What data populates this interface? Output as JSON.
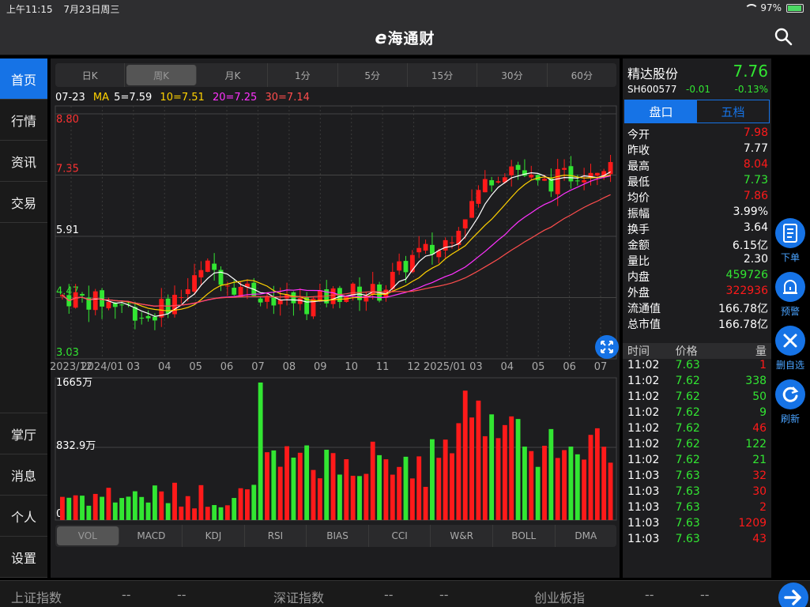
{
  "status": {
    "time": "上午11:15",
    "date": "7月23日周三",
    "battery": "97%"
  },
  "nav": {
    "logo_e": "e",
    "logo_text": "海通财"
  },
  "left_nav": {
    "top": [
      {
        "label": "首页"
      },
      {
        "label": "行情"
      },
      {
        "label": "资讯"
      },
      {
        "label": "交易"
      }
    ],
    "bottom": [
      {
        "label": "掌厅"
      },
      {
        "label": "消息"
      },
      {
        "label": "个人"
      },
      {
        "label": "设置"
      }
    ]
  },
  "period_tabs": [
    "日K",
    "周K",
    "月K",
    "1分",
    "5分",
    "15分",
    "30分",
    "60分"
  ],
  "active_period": 1,
  "ma": {
    "date": "07-23",
    "label": "MA",
    "ma5": "5=7.59",
    "ma10": "10=7.51",
    "ma20": "20=7.25",
    "ma30": "30=7.14"
  },
  "colors": {
    "up": "#ff1a1a",
    "down": "#32e632",
    "ma5": "#ffffff",
    "ma10": "#ffd200",
    "ma20": "#ff32ff",
    "ma30": "#ff4d4d",
    "accent": "#1673e6"
  },
  "price_axis": [
    "8.80",
    "7.35",
    "5.91",
    "4.47",
    "3.03"
  ],
  "date_axis": [
    "2023/12",
    "2024/01",
    "03",
    "04",
    "05",
    "06",
    "07",
    "08",
    "09",
    "10",
    "11",
    "12",
    "2025/01",
    "03",
    "04",
    "05",
    "06",
    "07"
  ],
  "vol_axis": [
    "1665万",
    "832.9万",
    "0"
  ],
  "indicator_tabs": [
    "VOL",
    "MACD",
    "KDJ",
    "RSI",
    "BIAS",
    "CCI",
    "W&R",
    "BOLL",
    "DMA"
  ],
  "active_indicator": 0,
  "stock": {
    "name": "精达股份",
    "price": "7.76",
    "code": "SH600577",
    "change": "-0.01",
    "change_pct": "-0.13%"
  },
  "panel_tabs": [
    "盘口",
    "五档"
  ],
  "quote": [
    {
      "k": "今开",
      "v": "7.98",
      "c": "up"
    },
    {
      "k": "昨收",
      "v": "7.77",
      "c": "flat"
    },
    {
      "k": "最高",
      "v": "8.04",
      "c": "up"
    },
    {
      "k": "最低",
      "v": "7.73",
      "c": "down"
    },
    {
      "k": "均价",
      "v": "7.86",
      "c": "up"
    },
    {
      "k": "振幅",
      "v": "3.99%",
      "c": "flat"
    },
    {
      "k": "换手",
      "v": "3.64",
      "c": "flat"
    },
    {
      "k": "金额",
      "v": "6.15亿",
      "c": "flat"
    },
    {
      "k": "量比",
      "v": "2.30",
      "c": "flat"
    },
    {
      "k": "内盘",
      "v": "459726",
      "c": "down"
    },
    {
      "k": "外盘",
      "v": "322936",
      "c": "up"
    },
    {
      "k": "流通值",
      "v": "166.78亿",
      "c": "flat"
    },
    {
      "k": "总市值",
      "v": "166.78亿",
      "c": "flat"
    }
  ],
  "ticks_head": [
    "时间",
    "价格",
    "量"
  ],
  "ticks": [
    [
      "11:02",
      "7.63",
      "1",
      "up"
    ],
    [
      "11:02",
      "7.62",
      "338",
      "down"
    ],
    [
      "11:02",
      "7.62",
      "50",
      "down"
    ],
    [
      "11:02",
      "7.62",
      "9",
      "down"
    ],
    [
      "11:02",
      "7.62",
      "46",
      "up"
    ],
    [
      "11:02",
      "7.62",
      "122",
      "down"
    ],
    [
      "11:02",
      "7.62",
      "21",
      "down"
    ],
    [
      "11:03",
      "7.63",
      "32",
      "up"
    ],
    [
      "11:03",
      "7.63",
      "30",
      "up"
    ],
    [
      "11:03",
      "7.63",
      "2",
      "up"
    ],
    [
      "11:03",
      "7.63",
      "1209",
      "up"
    ],
    [
      "11:03",
      "7.63",
      "43",
      "up"
    ]
  ],
  "float_buttons": [
    {
      "label": "下单",
      "icon": "order-icon"
    },
    {
      "label": "预警",
      "icon": "bell-icon"
    },
    {
      "label": "删自选",
      "icon": "close-icon"
    },
    {
      "label": "刷新",
      "icon": "refresh-icon"
    }
  ],
  "bottom_bar": [
    {
      "name": "上证指数",
      "v1": "--",
      "v2": "--"
    },
    {
      "name": "深证指数",
      "v1": "--",
      "v2": "--"
    },
    {
      "name": "创业板指",
      "v1": "--",
      "v2": "--"
    }
  ]
}
